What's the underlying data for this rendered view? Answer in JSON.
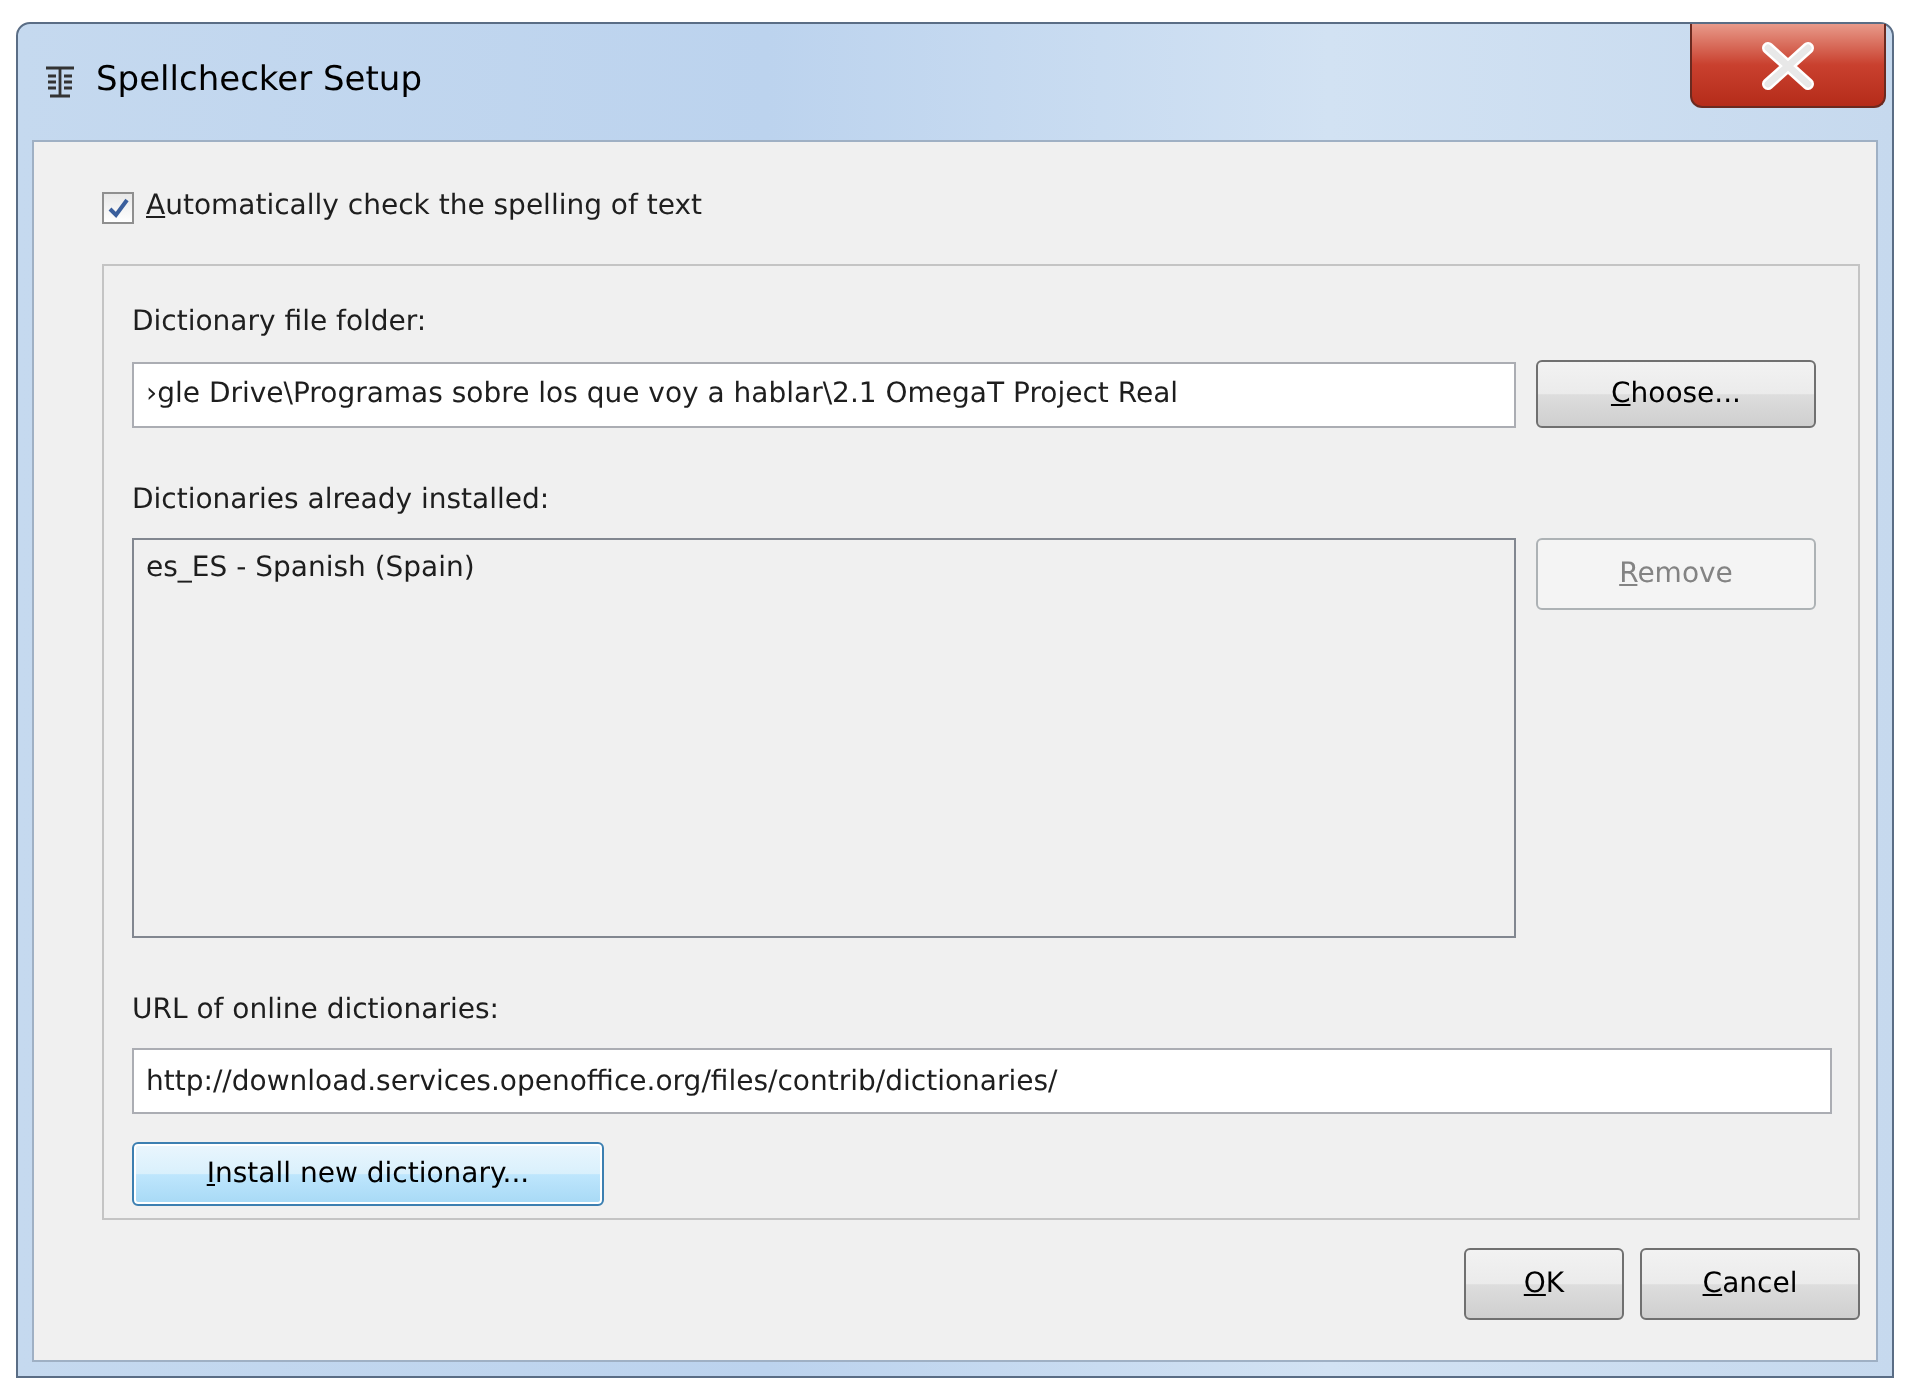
{
  "window": {
    "title": "Spellchecker Setup"
  },
  "auto_check": {
    "label": "Automatically check the spelling of text",
    "checked": true,
    "mnemonic": true
  },
  "folder": {
    "label": "Dictionary file folder:",
    "value": "›gle Drive\\Programas sobre los que voy a hablar\\2.1 OmegaT Project Real",
    "button": {
      "label": "Choose...",
      "disabled": false,
      "mnemonic": true
    }
  },
  "installed": {
    "label": "Dictionaries already installed:",
    "items": [
      {
        "label": "es_ES - Spanish (Spain)",
        "selected": false
      }
    ],
    "button": {
      "label": "Remove",
      "disabled": true,
      "mnemonic": true
    }
  },
  "url": {
    "label": "URL of online dictionaries:",
    "value": "http://download.services.openoffice.org/files/contrib/dictionaries/"
  },
  "install_button": {
    "label": "Install new dictionary...",
    "disabled": false,
    "focused": true,
    "mnemonic": true
  },
  "buttons": [
    {
      "label": "OK",
      "mnemonic": true
    },
    {
      "label": "Cancel",
      "mnemonic": true
    }
  ]
}
